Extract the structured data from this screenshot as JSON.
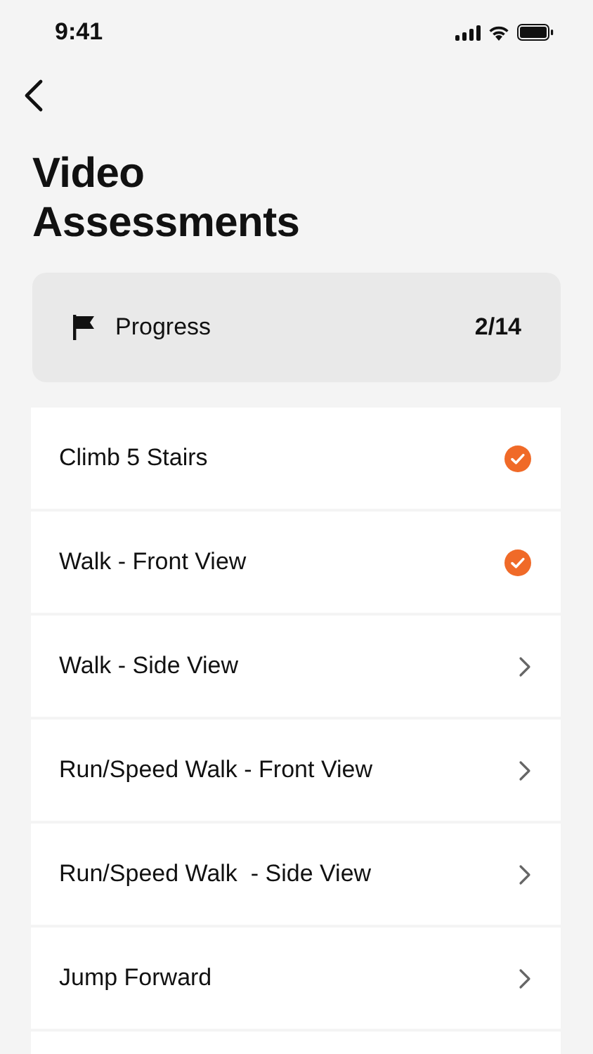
{
  "status_bar": {
    "time": "9:41"
  },
  "title": "Video Assessments",
  "progress": {
    "label": "Progress",
    "count": "2/14"
  },
  "assessments": [
    {
      "name": "Climb 5 Stairs",
      "completed": true
    },
    {
      "name": "Walk - Front View",
      "completed": true
    },
    {
      "name": "Walk - Side View",
      "completed": false
    },
    {
      "name": "Run/Speed Walk - Front View",
      "completed": false
    },
    {
      "name": "Run/Speed Walk  - Side View",
      "completed": false
    },
    {
      "name": "Jump Forward",
      "completed": false
    }
  ]
}
